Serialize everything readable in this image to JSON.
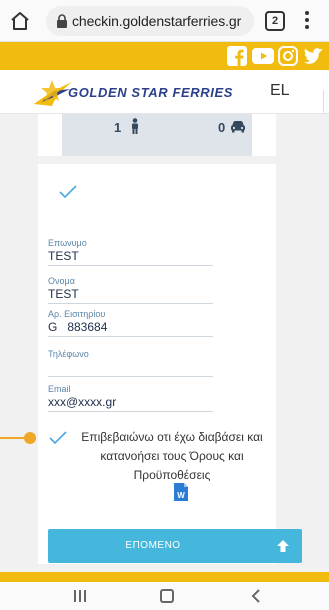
{
  "browser": {
    "url": "checkin.goldenstarferries.gr",
    "tab_count": "2"
  },
  "header": {
    "logo_text": "GOLDEN STAR FERRIES",
    "language": "EL"
  },
  "social": [
    "facebook-icon",
    "youtube-icon",
    "instagram-icon",
    "twitter-icon"
  ],
  "booking": {
    "passengers": "1",
    "vehicles": "0"
  },
  "form": {
    "surname": {
      "label": "Επωνυμο",
      "value": "TEST"
    },
    "name": {
      "label": "Ονομα",
      "value": "TEST"
    },
    "ticket": {
      "label": "Αρ. Εισιτηρίου",
      "value": "G   883684"
    },
    "phone": {
      "label": "Τηλέφωνο",
      "value": ""
    },
    "email": {
      "label": "Email",
      "value": "xxx@xxxx.gr"
    }
  },
  "consent": {
    "line1": "Επιβεβαιώνω οτι έχω διαβάσει και",
    "line2": "κατανοήσει τους Όρους και",
    "line3": "Προϋποθέσεις"
  },
  "next_button": {
    "label": "ΕΠΟΜΕΝΟ"
  },
  "colors": {
    "brand_yellow": "#f2bb0f",
    "button_blue": "#45b7dc",
    "brand_navy": "#2b3f8a",
    "check_blue": "#4aa9e0",
    "pointer_orange": "#f0a626"
  }
}
